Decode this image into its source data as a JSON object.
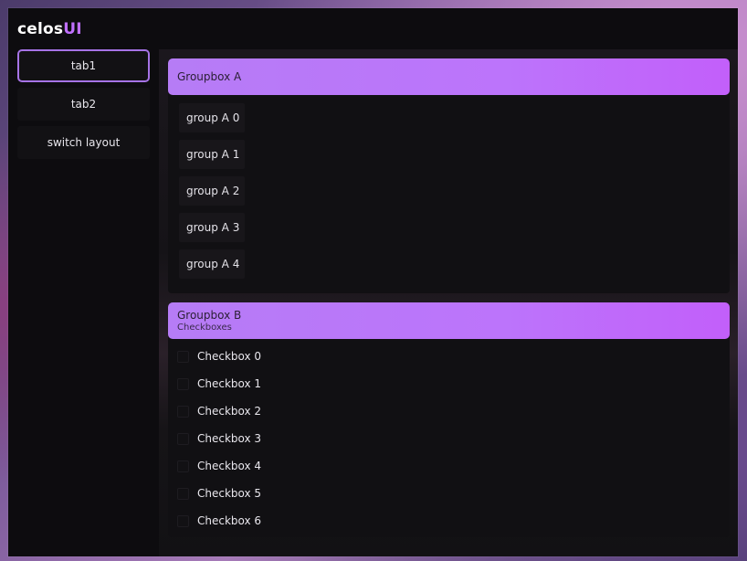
{
  "app": {
    "brand_main": "celos",
    "brand_accent": "UI",
    "accent_color": "#c070ff"
  },
  "sidebar": {
    "items": [
      {
        "label": "tab1",
        "active": true
      },
      {
        "label": "tab2",
        "active": false
      },
      {
        "label": "switch layout",
        "active": false
      }
    ]
  },
  "groupbox_a": {
    "title": "Groupbox A",
    "items": [
      "group A 0",
      "group A 1",
      "group A 2",
      "group A 3",
      "group A 4"
    ]
  },
  "groupbox_b": {
    "title": "Groupbox B",
    "subtitle": "Checkboxes",
    "checkboxes": [
      {
        "label": "Checkbox 0",
        "checked": false
      },
      {
        "label": "Checkbox 1",
        "checked": false
      },
      {
        "label": "Checkbox 2",
        "checked": false
      },
      {
        "label": "Checkbox 3",
        "checked": false
      },
      {
        "label": "Checkbox 4",
        "checked": false
      },
      {
        "label": "Checkbox 5",
        "checked": false
      },
      {
        "label": "Checkbox 6",
        "checked": false
      }
    ]
  }
}
